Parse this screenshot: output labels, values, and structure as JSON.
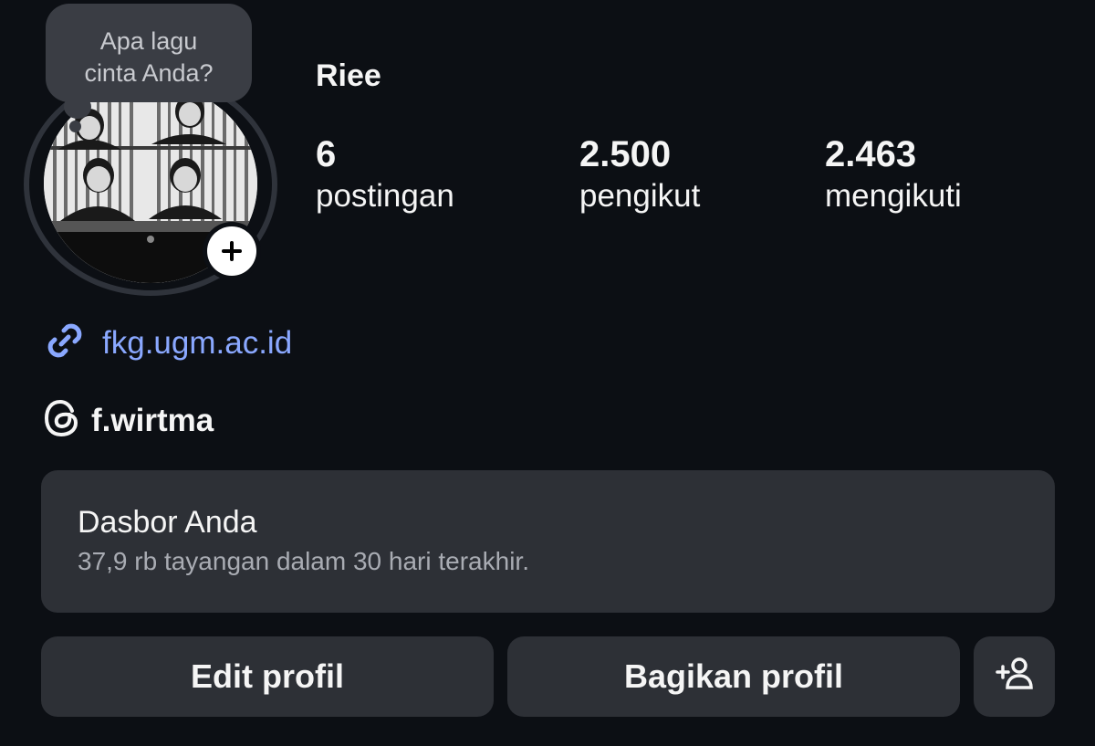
{
  "note": {
    "text_line1": "Apa lagu",
    "text_line2": "cinta Anda?"
  },
  "profile": {
    "username": "Riee"
  },
  "stats": [
    {
      "value": "6",
      "label": "postingan"
    },
    {
      "value": "2.500",
      "label": "pengikut"
    },
    {
      "value": "2.463",
      "label": "mengikuti"
    }
  ],
  "link": {
    "icon": "link-icon",
    "text": "fkg.ugm.ac.id",
    "color": "#8aa8ff"
  },
  "threads": {
    "icon": "threads-icon",
    "handle": "f.wirtma"
  },
  "dashboard": {
    "title": "Dasbor Anda",
    "subtitle": "37,9 rb tayangan dalam 30 hari terakhir."
  },
  "buttons": {
    "edit_profile": "Edit profil",
    "share_profile": "Bagikan profil",
    "add_user_icon": "add-person-icon"
  },
  "colors": {
    "background": "#0c0f14",
    "card": "#2d3036",
    "note_bubble": "#3a3d44"
  }
}
